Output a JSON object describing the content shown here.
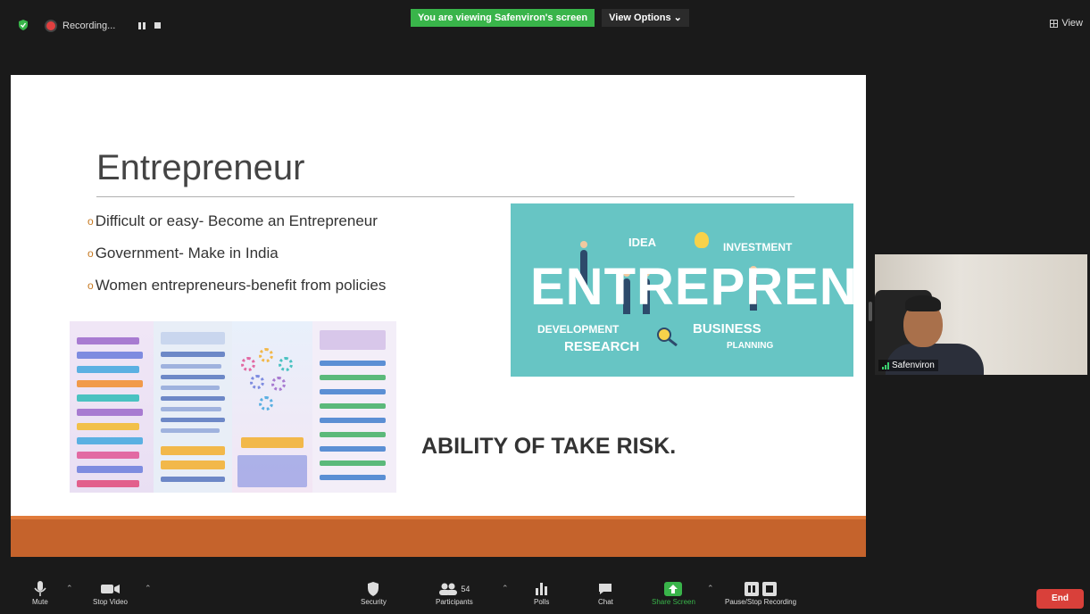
{
  "topbar": {
    "recording_label": "Recording...",
    "viewing_banner": "You are viewing Safenviron's screen",
    "view_options": "View Options ⌄",
    "view_label": "View"
  },
  "slide": {
    "title": "Entrepreneur",
    "bullets": [
      "Difficult or easy- Become an Entrepreneur",
      "Government- Make in India",
      "Women entrepreneurs-benefit from policies"
    ],
    "bullet_symbol": "o",
    "callout": "ABILITY OF TAKE RISK.",
    "image": {
      "word": "ENTREPRENEUR",
      "tags": [
        "IDEA",
        "INVESTMENT",
        "DEVELOPMENT",
        "RESEARCH",
        "BUSINESS",
        "PLANNING"
      ]
    }
  },
  "participant": {
    "name": "Safenviron"
  },
  "toolbar": {
    "mute": "Mute",
    "stop_video": "Stop Video",
    "security": "Security",
    "participants": "Participants",
    "participant_count": "54",
    "polls": "Polls",
    "chat": "Chat",
    "share_screen": "Share Screen",
    "pause_stop_recording": "Pause/Stop Recording",
    "end": "End"
  },
  "colors": {
    "share_green": "#39b44a",
    "end_red": "#d9403a",
    "slide_accent_orange": "#c5632c",
    "image_teal": "#67c5c4"
  }
}
